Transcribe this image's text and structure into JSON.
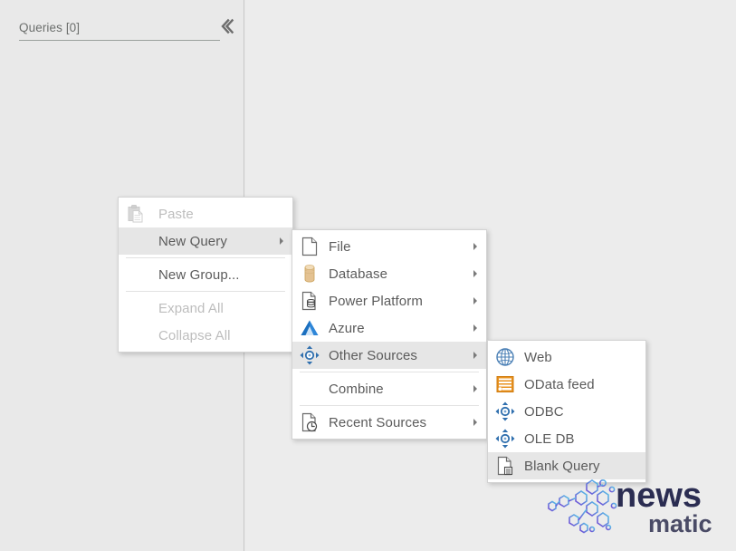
{
  "app": {
    "background_color": "#eaeaea",
    "pane_color": "#e9e9e9"
  },
  "queries_pane": {
    "title": "Queries [0]",
    "collapse_icon": "chevron-left-icon"
  },
  "context_menu": {
    "name": "query-context-menu",
    "items": [
      {
        "label": "Paste",
        "icon": "paste-icon",
        "disabled": true,
        "submenu": false,
        "selected": false,
        "separator_after": false
      },
      {
        "label": "New Query",
        "icon": null,
        "disabled": false,
        "submenu": true,
        "selected": true,
        "separator_after": false
      },
      {
        "label": "New Group...",
        "icon": null,
        "disabled": false,
        "submenu": false,
        "selected": false,
        "separator_after": false
      },
      {
        "label": "Expand All",
        "icon": null,
        "disabled": true,
        "submenu": false,
        "selected": false,
        "separator_after": false
      },
      {
        "label": "Collapse All",
        "icon": null,
        "disabled": true,
        "submenu": false,
        "selected": false,
        "separator_after": false
      }
    ]
  },
  "new_query_submenu": {
    "name": "new-query-submenu",
    "items": [
      {
        "label": "File",
        "icon": "file-icon",
        "disabled": false,
        "submenu": true,
        "selected": false
      },
      {
        "label": "Database",
        "icon": "database-icon",
        "disabled": false,
        "submenu": true,
        "selected": false
      },
      {
        "label": "Power Platform",
        "icon": "power-platform-icon",
        "disabled": false,
        "submenu": true,
        "selected": false
      },
      {
        "label": "Azure",
        "icon": "azure-icon",
        "disabled": false,
        "submenu": true,
        "selected": false
      },
      {
        "label": "Other Sources",
        "icon": "other-sources-icon",
        "disabled": false,
        "submenu": true,
        "selected": true
      },
      {
        "label": "Combine",
        "icon": null,
        "disabled": false,
        "submenu": true,
        "selected": false
      },
      {
        "label": "Recent Sources",
        "icon": "recent-sources-icon",
        "disabled": false,
        "submenu": true,
        "selected": false
      }
    ]
  },
  "other_sources_submenu": {
    "name": "other-sources-submenu",
    "items": [
      {
        "label": "Web",
        "icon": "web-globe-icon",
        "disabled": false,
        "submenu": false,
        "selected": false
      },
      {
        "label": "OData feed",
        "icon": "odata-feed-icon",
        "disabled": false,
        "submenu": false,
        "selected": false
      },
      {
        "label": "ODBC",
        "icon": "odbc-icon",
        "disabled": false,
        "submenu": false,
        "selected": false
      },
      {
        "label": "OLE DB",
        "icon": "oledb-icon",
        "disabled": false,
        "submenu": false,
        "selected": false
      },
      {
        "label": "Blank Query",
        "icon": "blank-query-icon",
        "disabled": false,
        "submenu": false,
        "selected": true
      }
    ]
  },
  "watermark": {
    "primary_text": "news",
    "secondary_text": "matic",
    "color": "#2b2d52",
    "accent_color": "#5b3fd6"
  },
  "colors": {
    "menu_background": "#ffffff",
    "menu_border": "#d3d3d3",
    "menu_text": "#5b5b5b",
    "menu_text_disabled": "#bdbdbd",
    "menu_highlight": "#e6e6e6",
    "azure_blue": "#2a7fd4",
    "odata_orange": "#e8921f",
    "database_tan": "#e3c08a"
  }
}
